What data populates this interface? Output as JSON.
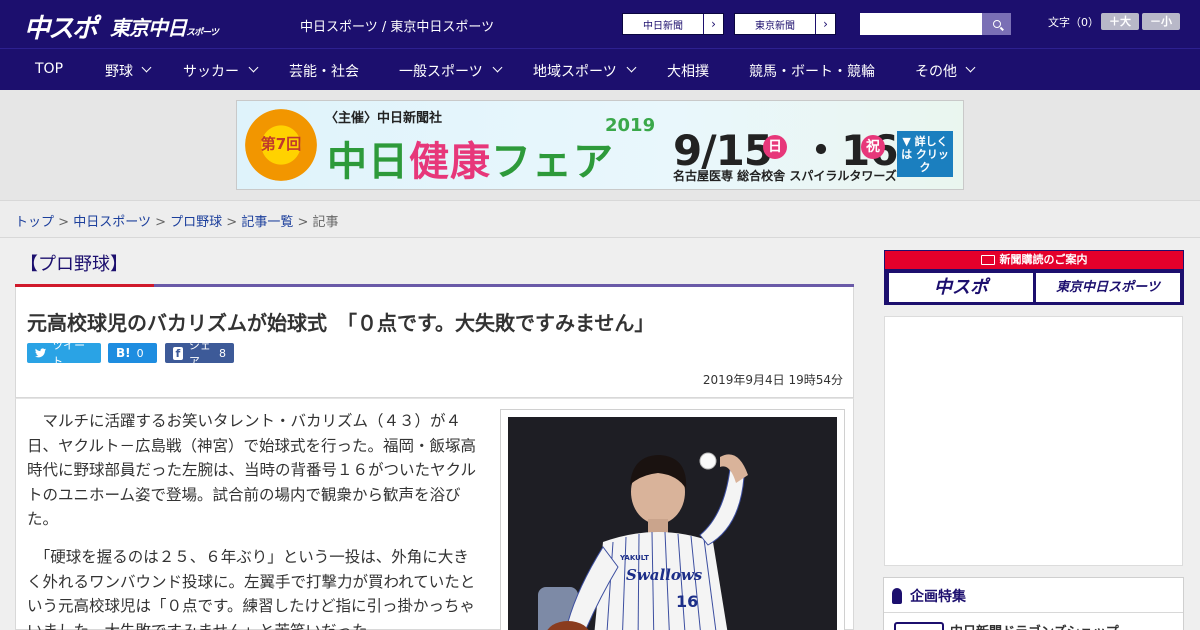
{
  "header": {
    "logo_main": "中スポ",
    "logo_tokyo": "東京中日",
    "logo_tokyo_sub": "スポーツ",
    "site_label": "中日スポーツ / 東京中日スポーツ",
    "paper_links": [
      {
        "label": "中日新聞"
      },
      {
        "label": "東京新聞"
      }
    ],
    "search": {
      "placeholder": "",
      "value": ""
    },
    "font_size_label": "文字（0）",
    "font_plus": "＋大",
    "font_minus": "－小"
  },
  "nav": {
    "items": [
      {
        "label": "TOP",
        "has_menu": false
      },
      {
        "label": "野球",
        "has_menu": true
      },
      {
        "label": "サッカー",
        "has_menu": true
      },
      {
        "label": "芸能・社会",
        "has_menu": false
      },
      {
        "label": "一般スポーツ",
        "has_menu": true
      },
      {
        "label": "地域スポーツ",
        "has_menu": true
      },
      {
        "label": "大相撲",
        "has_menu": false
      },
      {
        "label": "競馬・ボート・競輪",
        "has_menu": false
      },
      {
        "label": "その他",
        "has_menu": true
      }
    ]
  },
  "banner": {
    "badge": "第7回",
    "host": "〈主催〉中日新聞社",
    "title_a": "中日",
    "title_b": "健康",
    "title_c": "フェア",
    "year": "2019",
    "date": "9/15",
    "day1": "日",
    "date2": "・16",
    "day2": "祝",
    "venue": "名古屋医専 総合校舎 スパイラルタワーズ",
    "cta": "▼ 詳しくは クリック"
  },
  "breadcrumb": {
    "items": [
      "トップ",
      "中日スポーツ",
      "プロ野球",
      "記事一覧"
    ],
    "current": "記事",
    "sep": ">"
  },
  "article": {
    "section": "【プロ野球】",
    "title": "元高校球児のバカリズムが始球式　「０点です。大失敗ですみません」",
    "share": {
      "tweet_label": "ツイート",
      "hatena_icon": "B!",
      "hatena_count": "0",
      "facebook_icon": "f",
      "facebook_label": "シェア",
      "facebook_count": "8"
    },
    "date": "2019年9月4日 19時54分",
    "paragraphs": [
      "　マルチに活躍するお笑いタレント・バカリズム（４３）が４日、ヤクルト－広島戦（神宮）で始球式を行った。福岡・飯塚高時代に野球部員だった左腕は、当時の背番号１６がついたヤクルトのユニホーム姿で登場。試合前の場内で観衆から歓声を浴びた。",
      "　「硬球を握るのは２５、６年ぶり」という一投は、外角に大きく外れるワンバウンド投球に。左翼手で打撃力が買われていたという元高校球児は「０点です。練習したけど指に引っ掛かっちゃいました。大失敗ですみません」と苦笑いだった。"
    ],
    "photo": {
      "jersey_text": "Swallows",
      "number": "16",
      "logo": "YAKULT"
    }
  },
  "sidebar": {
    "subscribe_title": "新聞購読のご案内",
    "subscribe_buttons": [
      "中スポ",
      "東京中日スポーツ"
    ],
    "feature_title": "企画特集",
    "feature_item": "中日新聞ドラゴンズショップ"
  },
  "colors": {
    "brand": "#1c0f6e",
    "accent_red": "#d0192b",
    "twitter": "#2aa3e5",
    "hatena": "#1e8de0",
    "facebook": "#3d5a98"
  }
}
